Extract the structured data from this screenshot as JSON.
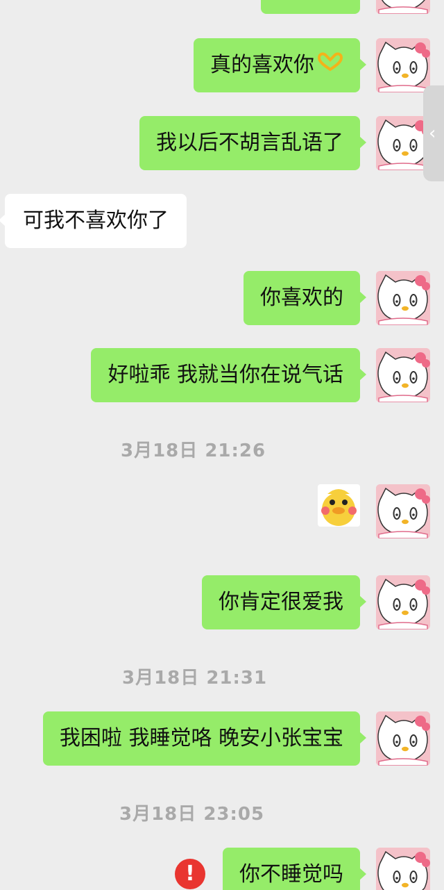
{
  "messages": {
    "m1": "真的喜欢你",
    "m2": "我以后不胡言乱语了",
    "m3": "可我不喜欢你了",
    "m4": "你喜欢的",
    "m5": "好啦乖 我就当你在说气话",
    "m6": "你肯定很爱我",
    "m7": "我困啦 我睡觉咯 晚安小张宝宝",
    "m8": "你不睡觉吗"
  },
  "timestamps": {
    "t1": "3月18日 21:26",
    "t2": "3月18日 21:31",
    "t3": "3月18日 23:05"
  },
  "icons": {
    "heart": "heart-hands-emoji",
    "error": "exclamation-error-icon",
    "avatar": "hello-kitty-avatar",
    "sticker": "yellow-duck-sticker",
    "side_tab": "chevron-left-icon"
  },
  "error_glyph": "!",
  "side_tab_glyph": "‹",
  "colors": {
    "background": "#ededed",
    "outgoing_bubble": "#95ec69",
    "incoming_bubble": "#ffffff",
    "timestamp": "#a9a9a9",
    "error": "#e93530",
    "avatar_bg": "#f4c2c9"
  }
}
